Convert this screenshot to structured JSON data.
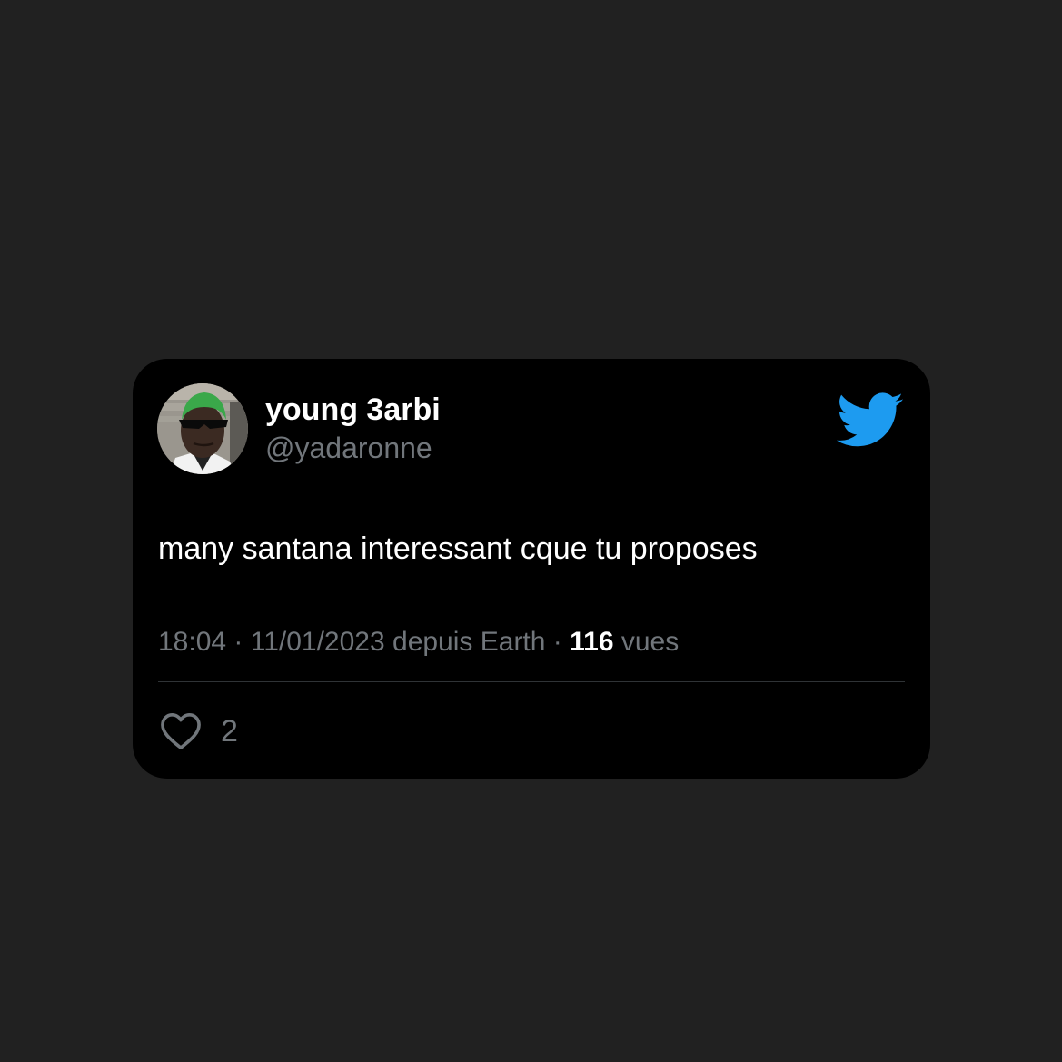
{
  "tweet": {
    "author": {
      "display_name": "young 3arbi",
      "handle": "@yadaronne",
      "avatar_icon": "avatar-photo"
    },
    "brand_icon": "twitter-bird-icon",
    "brand_color": "#1d9bf0",
    "text": "many santana interessant cque tu proposes",
    "meta": {
      "time": "18:04",
      "separator": " · ",
      "date": "11/01/2023",
      "source": " depuis Earth",
      "separator2": " · ",
      "views_count": "116",
      "views_label": " vues"
    },
    "likes": {
      "icon": "heart-icon",
      "count": "2"
    }
  },
  "colors": {
    "page_background": "#212121",
    "card_background": "#000000",
    "primary_text": "#ffffff",
    "secondary_text": "#71767b"
  }
}
